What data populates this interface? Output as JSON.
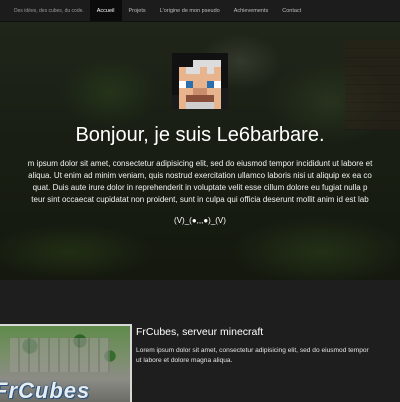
{
  "nav": {
    "brand": "Des idées, des cubes, du code.",
    "items": [
      {
        "label": "Accueil",
        "active": true
      },
      {
        "label": "Projets",
        "active": false
      },
      {
        "label": "L'origine de mon pseudo",
        "active": false
      },
      {
        "label": "Achievements",
        "active": false
      },
      {
        "label": "Contact",
        "active": false
      }
    ]
  },
  "hero": {
    "title": "Bonjour, je suis Le6barbare.",
    "text_lines": [
      "m ipsum dolor sit amet, consectetur adipisicing elit, sed do eiusmod tempor incididunt ut labore et",
      "aliqua. Ut enim ad minim veniam, quis nostrud exercitation ullamco laboris nisi ut aliquip ex ea co",
      "quat. Duis aute irure dolor in reprehenderit in voluptate velit esse cillum dolore eu fugiat nulla p",
      "teur sint occaecat cupidatat non proident, sunt in culpa qui officia deserunt mollit anim id est lab"
    ],
    "face": "(V)_(●,,,●)_(V)"
  },
  "project": {
    "thumbnail_text": "FrCubes",
    "title": "FrCubes, serveur minecraft",
    "text_lines": [
      "Lorem ipsum dolor sit amet, consectetur adipisicing elit, sed do eiusmod tempor",
      "ut labore et dolore magna aliqua."
    ]
  }
}
